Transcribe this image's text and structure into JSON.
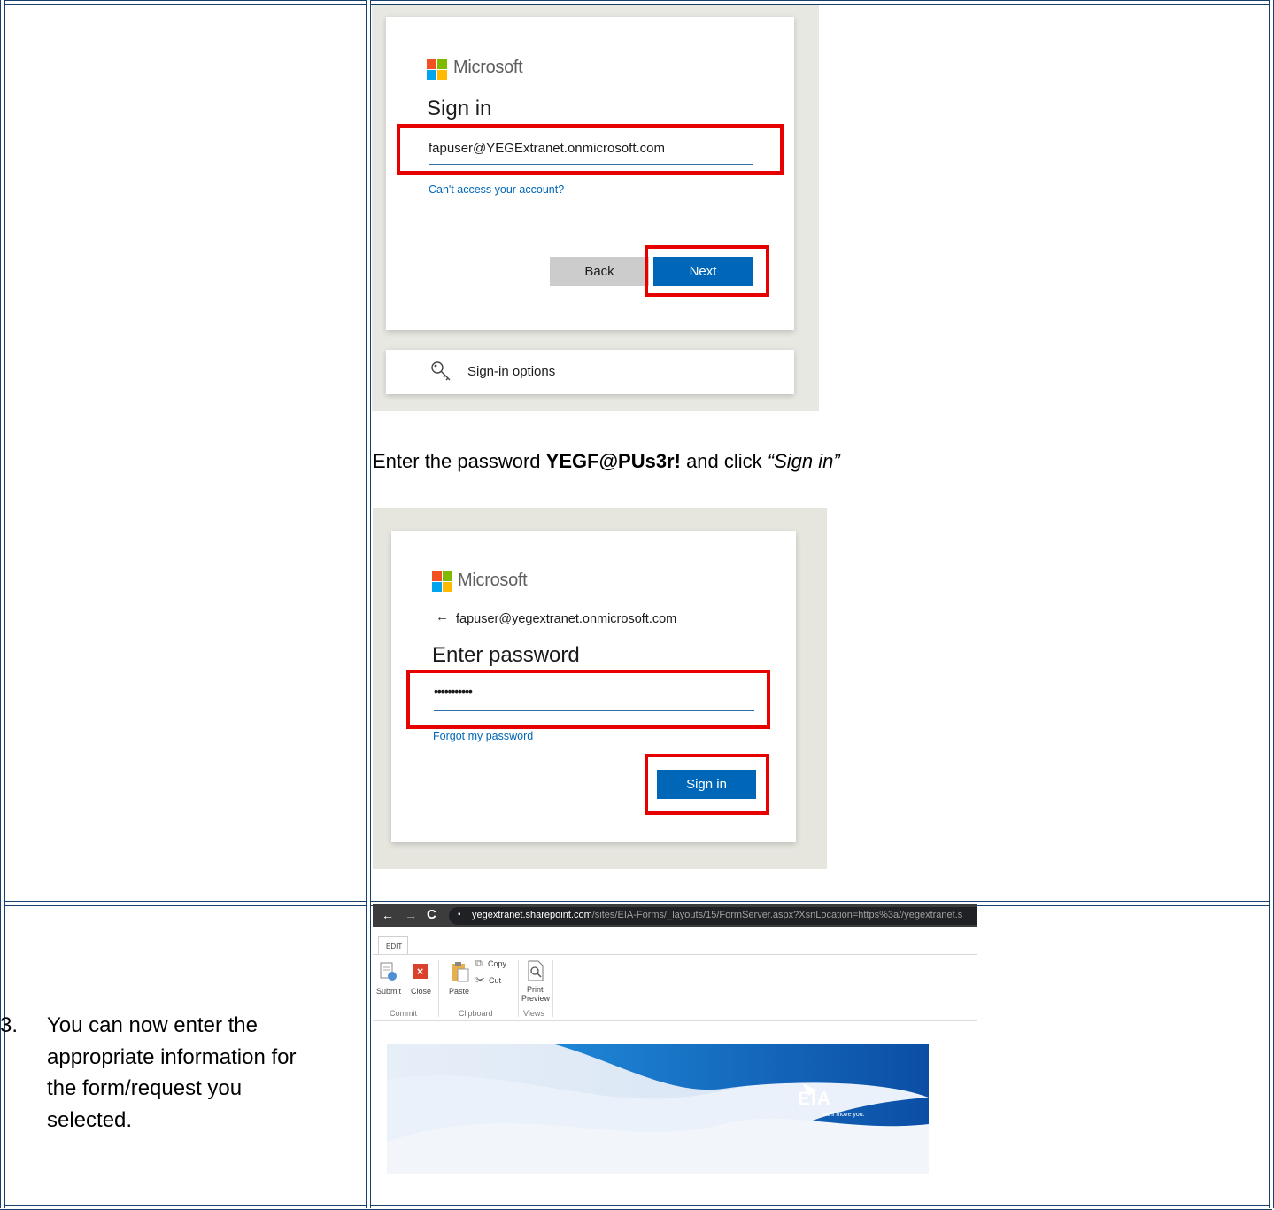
{
  "shot1": {
    "brand": "Microsoft",
    "title": "Sign in",
    "email": "fapuser@YEGExtranet.onmicrosoft.com",
    "cant_access": "Can't access your account?",
    "back_label": "Back",
    "next_label": "Next",
    "options_label": "Sign-in options"
  },
  "caption": {
    "prefix": "Enter the password ",
    "password": "YEGF@PUs3r!",
    "middle": " and click ",
    "action": "“Sign in”"
  },
  "shot2": {
    "brand": "Microsoft",
    "back_email": "fapuser@yegextranet.onmicrosoft.com",
    "title": "Enter password",
    "password_mask": "•••••••••••",
    "forgot": "Forgot my password",
    "signin_label": "Sign in"
  },
  "step3": {
    "number": "3.",
    "text_line1": "You can now enter the",
    "text_line2": "appropriate information for",
    "text_line3": "the form/request you",
    "text_line4": "selected."
  },
  "browser": {
    "url_host": "yegextranet.sharepoint.com",
    "url_path": "/sites/EIA-Forms/_layouts/15/FormServer.aspx?XsnLocation=https%3a//yegextranet.s"
  },
  "ribbon": {
    "tab": "EDIT",
    "submit": "Submit",
    "close": "Close",
    "paste": "Paste",
    "copy": "Copy",
    "cut": "Cut",
    "print": "Print",
    "preview": "Preview",
    "group_commit": "Commit",
    "group_clipboard": "Clipboard",
    "group_views": "Views"
  },
  "banner": {
    "logo": "EIA",
    "tagline": "we'll move you."
  },
  "colors": {
    "border": "#17406d",
    "accent": "#0067b8",
    "highlight": "#e60000"
  }
}
